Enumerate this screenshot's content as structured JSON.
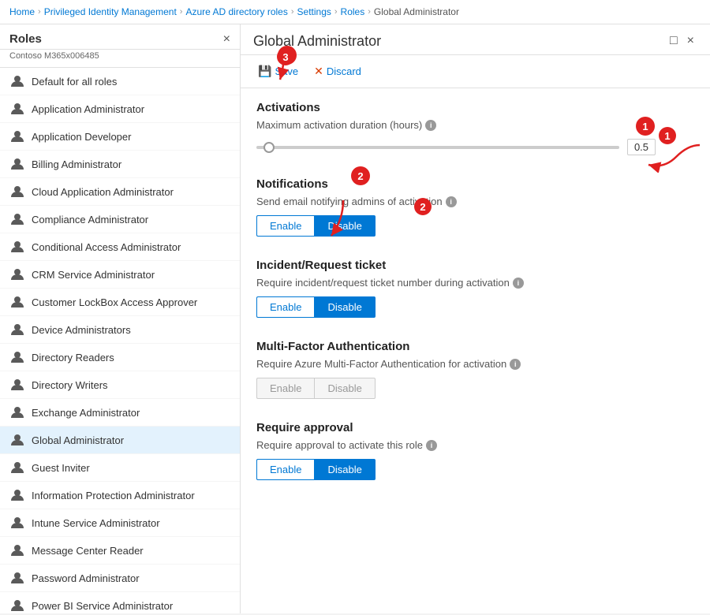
{
  "breadcrumb": {
    "items": [
      {
        "label": "Home",
        "link": true
      },
      {
        "label": "Privileged Identity Management",
        "link": true
      },
      {
        "label": "Azure AD directory roles",
        "link": true
      },
      {
        "label": "Settings",
        "link": true
      },
      {
        "label": "Roles",
        "link": true
      },
      {
        "label": "Global Administrator",
        "link": false
      }
    ]
  },
  "sidebar": {
    "title": "Roles",
    "subtitle": "Contoso M365x006485",
    "close_label": "×",
    "items": [
      {
        "label": "Default for all roles",
        "active": false
      },
      {
        "label": "Application Administrator",
        "active": false
      },
      {
        "label": "Application Developer",
        "active": false
      },
      {
        "label": "Billing Administrator",
        "active": false
      },
      {
        "label": "Cloud Application Administrator",
        "active": false
      },
      {
        "label": "Compliance Administrator",
        "active": false
      },
      {
        "label": "Conditional Access Administrator",
        "active": false
      },
      {
        "label": "CRM Service Administrator",
        "active": false
      },
      {
        "label": "Customer LockBox Access Approver",
        "active": false
      },
      {
        "label": "Device Administrators",
        "active": false
      },
      {
        "label": "Directory Readers",
        "active": false
      },
      {
        "label": "Directory Writers",
        "active": false
      },
      {
        "label": "Exchange Administrator",
        "active": false
      },
      {
        "label": "Global Administrator",
        "active": true
      },
      {
        "label": "Guest Inviter",
        "active": false
      },
      {
        "label": "Information Protection Administrator",
        "active": false
      },
      {
        "label": "Intune Service Administrator",
        "active": false
      },
      {
        "label": "Message Center Reader",
        "active": false
      },
      {
        "label": "Password Administrator",
        "active": false
      },
      {
        "label": "Power BI Service Administrator",
        "active": false
      }
    ]
  },
  "panel": {
    "title": "Global Administrator",
    "toolbar": {
      "save_label": "Save",
      "discard_label": "Discard"
    },
    "sections": {
      "activations": {
        "title": "Activations",
        "duration_label": "Maximum activation duration (hours)",
        "slider_min": 0,
        "slider_max": 24,
        "slider_value": 0.5,
        "slider_display": "0.5"
      },
      "notifications": {
        "title": "Notifications",
        "desc": "Send email notifying admins of activation",
        "enable_label": "Enable",
        "disable_label": "Disable",
        "active": "disable"
      },
      "incident": {
        "title": "Incident/Request ticket",
        "desc": "Require incident/request ticket number during activation",
        "enable_label": "Enable",
        "disable_label": "Disable",
        "active": "disable"
      },
      "mfa": {
        "title": "Multi-Factor Authentication",
        "desc": "Require Azure Multi-Factor Authentication for activation",
        "enable_label": "Enable",
        "disable_label": "Disable",
        "active": "none"
      },
      "approval": {
        "title": "Require approval",
        "desc": "Require approval to activate this role",
        "enable_label": "Enable",
        "disable_label": "Disable",
        "active": "disable"
      }
    },
    "annotations": [
      {
        "number": "1",
        "desc": "slider annotation"
      },
      {
        "number": "2",
        "desc": "notifications annotation"
      },
      {
        "number": "3",
        "desc": "save annotation"
      }
    ]
  },
  "icons": {
    "person": "🧑",
    "save": "💾",
    "discard": "✕",
    "info": "i",
    "close": "×",
    "maximize": "□"
  }
}
